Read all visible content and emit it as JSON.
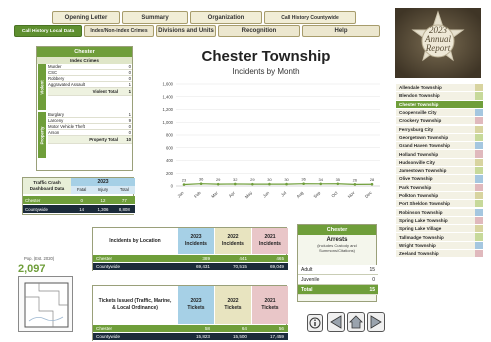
{
  "top_tabs": [
    "Opening Letter",
    "Summary",
    "Organization",
    "Call History Countywide"
  ],
  "second_tabs": [
    "Call History Local Data",
    "Index/Non-index Crimes",
    "Divisions and Units",
    "Recognition",
    "Help"
  ],
  "active_tab": "Call History Local Data",
  "report_badge": {
    "year": "2023",
    "line1": "Annual",
    "line2": "Report"
  },
  "crime_box": {
    "title": "Chester",
    "subtitle": "Index Crimes",
    "violent_label": "Violent",
    "property_label": "Property",
    "violent": [
      {
        "label": "Murder",
        "value": "0"
      },
      {
        "label": "CSC",
        "value": "0"
      },
      {
        "label": "Robbery",
        "value": "0"
      },
      {
        "label": "Aggravated Assault",
        "value": "1"
      }
    ],
    "violent_total": {
      "label": "Violent Total",
      "value": "1"
    },
    "property": [
      {
        "label": "Burglary",
        "value": "1"
      },
      {
        "label": "Larceny",
        "value": "9"
      },
      {
        "label": "Motor Vehicle Theft",
        "value": "0"
      },
      {
        "label": "Arson",
        "value": "0"
      }
    ],
    "property_total": {
      "label": "Property Total",
      "value": "10"
    }
  },
  "traffic_box": {
    "title": "Traffic Crash Dashboard Data",
    "year": "2023",
    "cols": [
      "Fatal",
      "Injury",
      "Total"
    ],
    "rows": [
      {
        "label": "Chester",
        "values": [
          "0",
          "12",
          "77"
        ]
      },
      {
        "label": "Countywide",
        "values": [
          "14",
          "1,306",
          "8,808"
        ]
      }
    ]
  },
  "population": {
    "label": "Pop. (Est. 2020)",
    "value": "2,097"
  },
  "chart_data": {
    "type": "line",
    "title": "Chester Township",
    "subtitle": "Incidents by Month",
    "categories": [
      "Jan",
      "Feb",
      "Mar",
      "Apr",
      "May",
      "Jun",
      "Jul",
      "Aug",
      "Sep",
      "Oct",
      "Nov",
      "Dec"
    ],
    "series": [
      {
        "name": "",
        "values": [
          23,
          36,
          29,
          32,
          29,
          30,
          30,
          36,
          34,
          35,
          26,
          28
        ]
      }
    ],
    "ylim": [
      0,
      1600
    ],
    "yticks": [
      "0",
      "200",
      "400",
      "600",
      "800",
      "1,000",
      "1,200",
      "1,400",
      "1,600"
    ],
    "colors": {
      "line": "#6f9e3a",
      "label": "#444444"
    },
    "grid": true
  },
  "location_table": {
    "title": "Incidents by Location",
    "cols": [
      {
        "year": "2023",
        "label": "Incidents",
        "color": "#a6d0e6"
      },
      {
        "year": "2022",
        "label": "Incidents",
        "color": "#e8e4c0"
      },
      {
        "year": "2021",
        "label": "Incidents",
        "color": "#e9c6c8"
      }
    ],
    "rows": [
      {
        "label": "Chester",
        "values": [
          "389",
          "441",
          "465"
        ]
      },
      {
        "label": "Countywide",
        "values": [
          "69,431",
          "70,515",
          "69,049"
        ]
      }
    ]
  },
  "tickets_table": {
    "title": "Tickets Issued (Traffic, Marine, & Local Ordinance)",
    "cols": [
      {
        "year": "2023",
        "label": "Tickets",
        "color": "#a6d0e6"
      },
      {
        "year": "2022",
        "label": "Tickets",
        "color": "#e8e4c0"
      },
      {
        "year": "2021",
        "label": "Tickets",
        "color": "#e9c6c8"
      }
    ],
    "rows": [
      {
        "label": "Chester",
        "values": [
          "58",
          "64",
          "56"
        ]
      },
      {
        "label": "Countywide",
        "values": [
          "15,823",
          "15,500",
          "17,459"
        ]
      }
    ]
  },
  "arrests": {
    "title": "Chester",
    "heading": "Arrests",
    "note": "(includes Custody and Summons/Citations)",
    "rows": [
      {
        "label": "Adult",
        "value": "15"
      },
      {
        "label": "Juvenile",
        "value": "0"
      }
    ],
    "total": {
      "label": "Total",
      "value": "15"
    }
  },
  "nav_icons": [
    "info-icon",
    "home-icon",
    "back-arrow-icon",
    "forward-arrow-icon"
  ],
  "townships": [
    {
      "name": "Allendale Township",
      "color": "#d8d4a0"
    },
    {
      "name": "Blendon Township",
      "color": "#c7d99a"
    },
    {
      "name": "Chester Township",
      "color": "#6f9e3a"
    },
    {
      "name": "Coopersville City",
      "color": "#a5c7e0"
    },
    {
      "name": "Crockery Township",
      "color": "#e0b9bd"
    },
    {
      "name": "Ferrysburg City",
      "color": "#d8d4a0"
    },
    {
      "name": "Georgetown Township",
      "color": "#c7d99a"
    },
    {
      "name": "Grand Haven Township",
      "color": "#a5c7e0"
    },
    {
      "name": "Holland Township",
      "color": "#e0b9bd"
    },
    {
      "name": "Hudsonville City",
      "color": "#d8d4a0"
    },
    {
      "name": "Jamestown Township",
      "color": "#c7d99a"
    },
    {
      "name": "Olive Township",
      "color": "#a5c7e0"
    },
    {
      "name": "Park Township",
      "color": "#e0b9bd"
    },
    {
      "name": "Polkton Township",
      "color": "#d8d4a0"
    },
    {
      "name": "Port Sheldon Township",
      "color": "#c7d99a"
    },
    {
      "name": "Robinson Township",
      "color": "#a5c7e0"
    },
    {
      "name": "Spring Lake Township",
      "color": "#e0b9bd"
    },
    {
      "name": "Spring Lake Village",
      "color": "#d8d4a0"
    },
    {
      "name": "Tallmadge Township",
      "color": "#c7d99a"
    },
    {
      "name": "Wright Township",
      "color": "#a5c7e0"
    },
    {
      "name": "Zeeland Township",
      "color": "#e0b9bd"
    }
  ]
}
